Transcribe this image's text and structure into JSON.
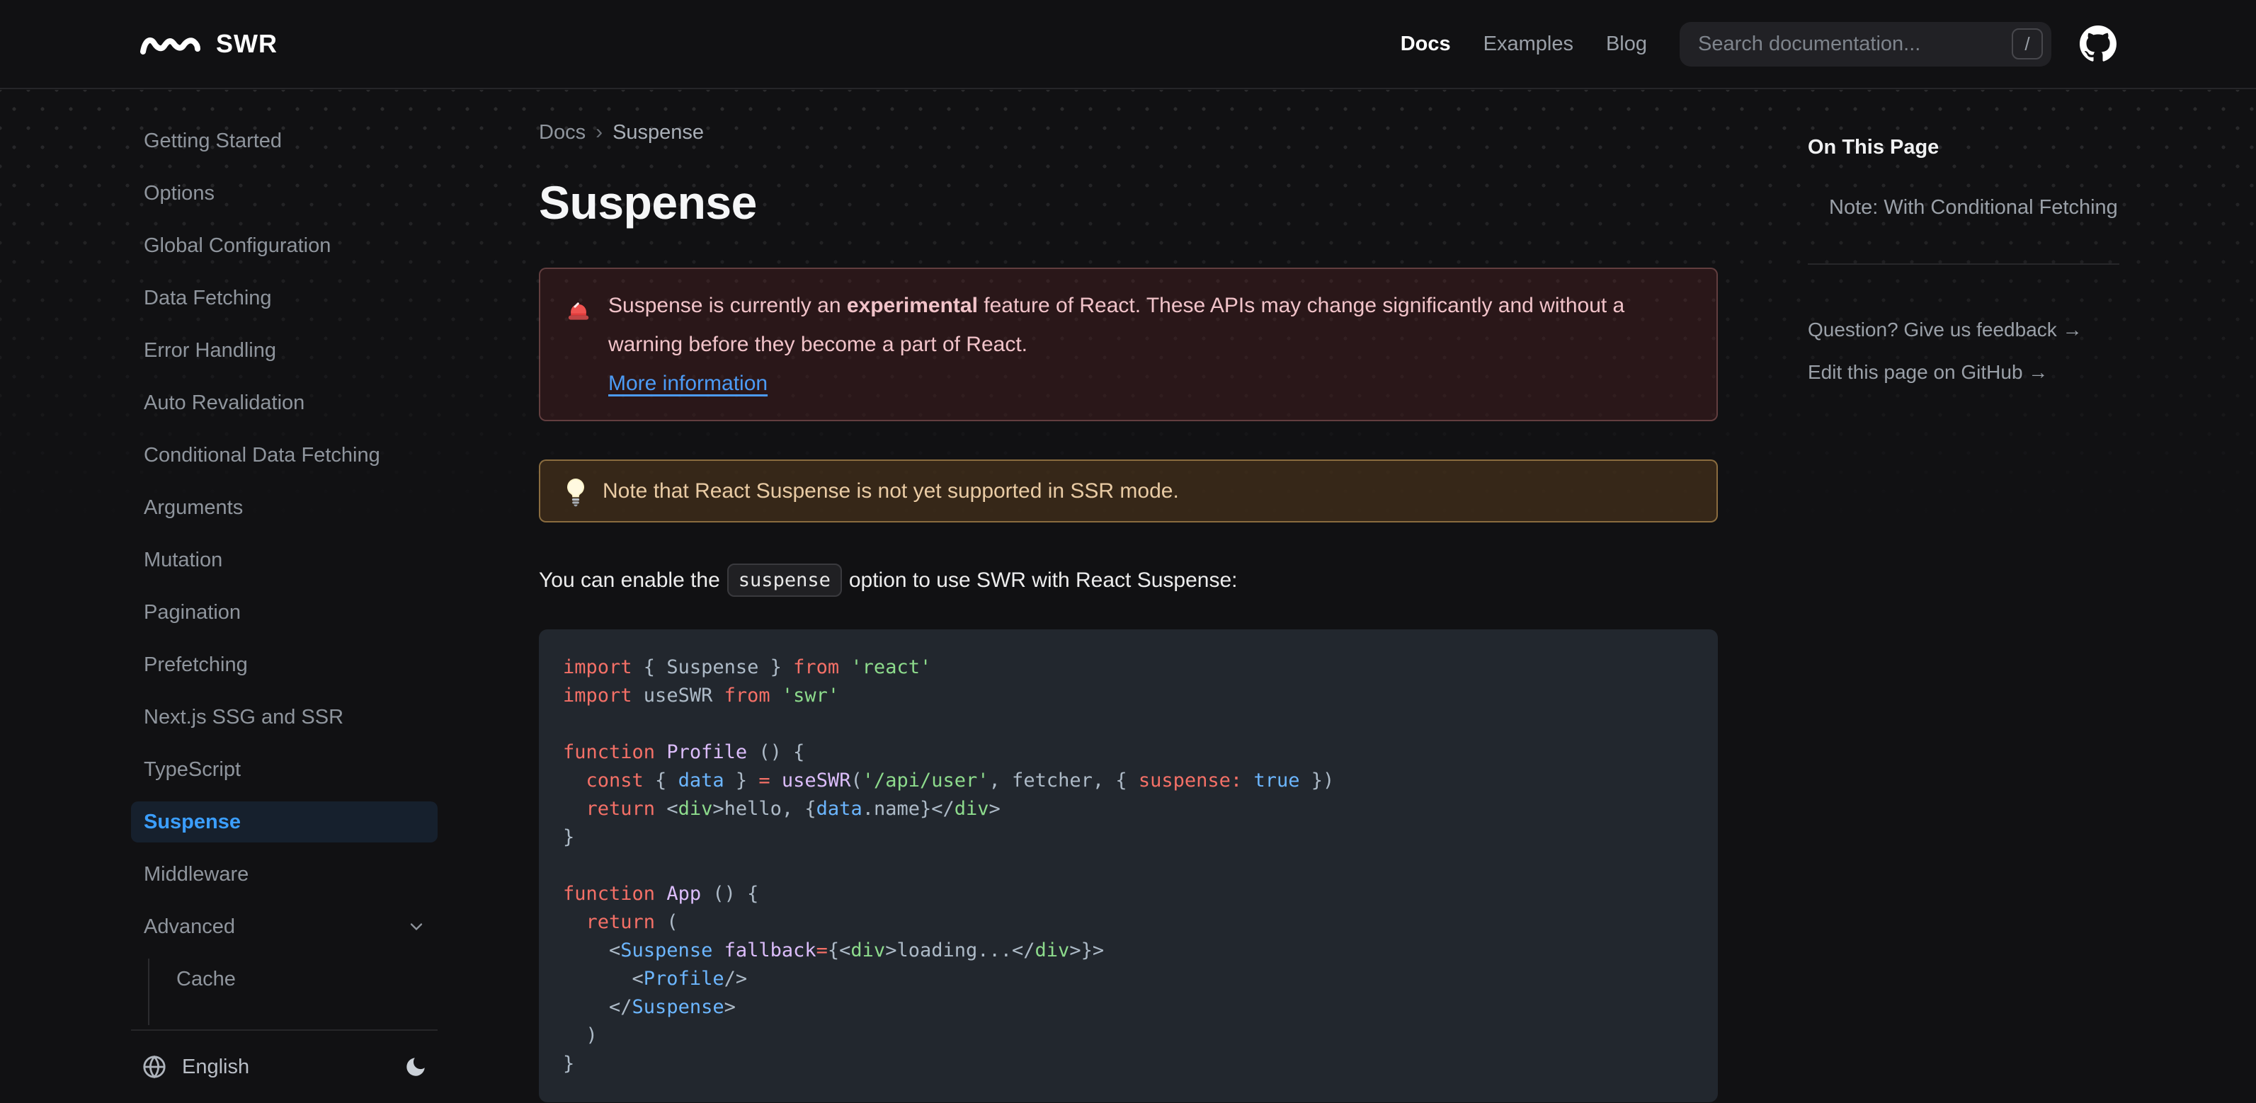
{
  "navbar": {
    "logo_text": "SWR",
    "links": [
      {
        "label": "Docs",
        "active": true
      },
      {
        "label": "Examples",
        "active": false
      },
      {
        "label": "Blog",
        "active": false
      }
    ],
    "search_placeholder": "Search documentation...",
    "search_kbd": "/"
  },
  "sidebar": {
    "items": [
      {
        "label": "Getting Started"
      },
      {
        "label": "Options"
      },
      {
        "label": "Global Configuration"
      },
      {
        "label": "Data Fetching"
      },
      {
        "label": "Error Handling"
      },
      {
        "label": "Auto Revalidation"
      },
      {
        "label": "Conditional Data Fetching"
      },
      {
        "label": "Arguments"
      },
      {
        "label": "Mutation"
      },
      {
        "label": "Pagination"
      },
      {
        "label": "Prefetching"
      },
      {
        "label": "Next.js SSG and SSR"
      },
      {
        "label": "TypeScript"
      },
      {
        "label": "Suspense",
        "active": true
      },
      {
        "label": "Middleware"
      },
      {
        "label": "Advanced",
        "expandable": true,
        "children": [
          {
            "label": "Cache"
          }
        ]
      }
    ],
    "language": "English",
    "icons": {
      "language": "globe-icon",
      "theme": "moon-icon",
      "expand": "chevron-down-icon"
    }
  },
  "breadcrumb": [
    "Docs",
    "Suspense"
  ],
  "page": {
    "title": "Suspense"
  },
  "callouts": {
    "error": {
      "icon": "rotating-light-emoji",
      "text_before": "Suspense is currently an ",
      "bold": "experimental",
      "text_after": " feature of React. These APIs may change significantly and without a warning before they become a part of React.",
      "link": "More information"
    },
    "warning": {
      "icon": "light-bulb-emoji",
      "text": "Note that React Suspense is not yet supported in SSR mode."
    }
  },
  "intro": {
    "before": "You can enable the ",
    "code": "suspense",
    "after": " option to use SWR with React Suspense:"
  },
  "code": {
    "lines": [
      [
        [
          "k",
          "import"
        ],
        [
          "d",
          " { Suspense } "
        ],
        [
          "k",
          "from"
        ],
        [
          "d",
          " "
        ],
        [
          "s",
          "'react'"
        ]
      ],
      [
        [
          "k",
          "import"
        ],
        [
          "d",
          " useSWR "
        ],
        [
          "k",
          "from"
        ],
        [
          "d",
          " "
        ],
        [
          "s",
          "'swr'"
        ]
      ],
      [],
      [
        [
          "k",
          "function"
        ],
        [
          "d",
          " "
        ],
        [
          "f",
          "Profile"
        ],
        [
          "d",
          " () {"
        ]
      ],
      [
        [
          "d",
          "  "
        ],
        [
          "k",
          "const"
        ],
        [
          "d",
          " { "
        ],
        [
          "v",
          "data"
        ],
        [
          "d",
          " } "
        ],
        [
          "k",
          "="
        ],
        [
          "d",
          " "
        ],
        [
          "f",
          "useSWR"
        ],
        [
          "d",
          "("
        ],
        [
          "s",
          "'/api/user'"
        ],
        [
          "d",
          ", fetcher, { "
        ],
        [
          "k",
          "suspense:"
        ],
        [
          "d",
          " "
        ],
        [
          "v",
          "true"
        ],
        [
          "d",
          " })"
        ]
      ],
      [
        [
          "d",
          "  "
        ],
        [
          "k",
          "return"
        ],
        [
          "d",
          " <"
        ],
        [
          "t",
          "div"
        ],
        [
          "d",
          ">hello, {"
        ],
        [
          "v",
          "data"
        ],
        [
          "d",
          ".name}</"
        ],
        [
          "t",
          "div"
        ],
        [
          "d",
          ">"
        ]
      ],
      [
        [
          "d",
          "}"
        ]
      ],
      [],
      [
        [
          "k",
          "function"
        ],
        [
          "d",
          " "
        ],
        [
          "f",
          "App"
        ],
        [
          "d",
          " () {"
        ]
      ],
      [
        [
          "d",
          "  "
        ],
        [
          "k",
          "return"
        ],
        [
          "d",
          " ("
        ]
      ],
      [
        [
          "d",
          "    <"
        ],
        [
          "v",
          "Suspense"
        ],
        [
          "d",
          " "
        ],
        [
          "f",
          "fallback"
        ],
        [
          "k",
          "="
        ],
        [
          "d",
          "{<"
        ],
        [
          "t",
          "div"
        ],
        [
          "d",
          ">loading...</"
        ],
        [
          "t",
          "div"
        ],
        [
          "d",
          ">}>"
        ]
      ],
      [
        [
          "d",
          "      <"
        ],
        [
          "v",
          "Profile"
        ],
        [
          "d",
          "/>"
        ]
      ],
      [
        [
          "d",
          "    </"
        ],
        [
          "v",
          "Suspense"
        ],
        [
          "d",
          ">"
        ]
      ],
      [
        [
          "d",
          "  )"
        ]
      ],
      [
        [
          "d",
          "}"
        ]
      ]
    ]
  },
  "toc": {
    "heading": "On This Page",
    "items": [
      "Note: With Conditional Fetching"
    ],
    "feedback": "Question? Give us feedback →",
    "edit": "Edit this page on GitHub →"
  },
  "colors": {
    "accent_blue": "#3b9eff",
    "link_blue": "#4c9bf5",
    "code_keyword": "#f47067",
    "code_string": "#8ddb8c",
    "code_function": "#dcbdfb",
    "code_constant": "#6cb6ff",
    "error_text": "#f1c3c9",
    "warning_text": "#e9cba4"
  }
}
